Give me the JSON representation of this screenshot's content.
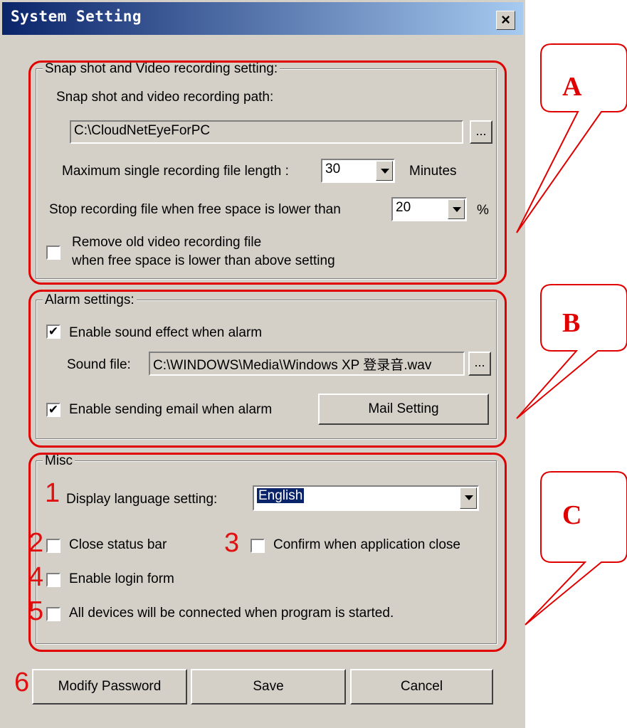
{
  "window": {
    "title": "System Setting",
    "close_label": "×"
  },
  "snapshot": {
    "legend": "Snap shot and Video recording setting:",
    "path_label": "Snap shot and video recording path:",
    "path_value": "C:\\CloudNetEyeForPC",
    "browse_label": "...",
    "max_length_label": "Maximum single recording file length :",
    "max_length_value": "30",
    "max_length_unit": "Minutes",
    "stop_label": "Stop recording file when free space is lower than",
    "stop_value": "20",
    "stop_unit": "%",
    "remove_old_line1": "Remove old video recording file",
    "remove_old_line2": "when free space is lower than above setting",
    "remove_old_checked": false
  },
  "alarm": {
    "legend": "Alarm settings:",
    "sound_enable_label": "Enable sound effect when alarm",
    "sound_enable_checked": true,
    "sound_file_label": "Sound file:",
    "sound_file_value": "C:\\WINDOWS\\Media\\Windows XP 登录音.wav",
    "browse_label": "...",
    "email_enable_label": "Enable sending email when alarm",
    "email_enable_checked": true,
    "mail_setting_label": "Mail Setting"
  },
  "misc": {
    "legend": "Misc",
    "language_label": "Display language setting:",
    "language_value": "English",
    "close_status_bar_label": "Close status bar",
    "confirm_close_label": "Confirm when application close",
    "login_form_label": "Enable login form",
    "connect_all_label": "All devices will be connected when program is started."
  },
  "buttons": {
    "modify_password": "Modify Password",
    "save": "Save",
    "cancel": "Cancel"
  },
  "annotations": {
    "letters": [
      "A",
      "B",
      "C"
    ],
    "numbers": [
      "1",
      "2",
      "3",
      "4",
      "5",
      "6"
    ],
    "color": "#e00000"
  },
  "check_mark": "✔"
}
